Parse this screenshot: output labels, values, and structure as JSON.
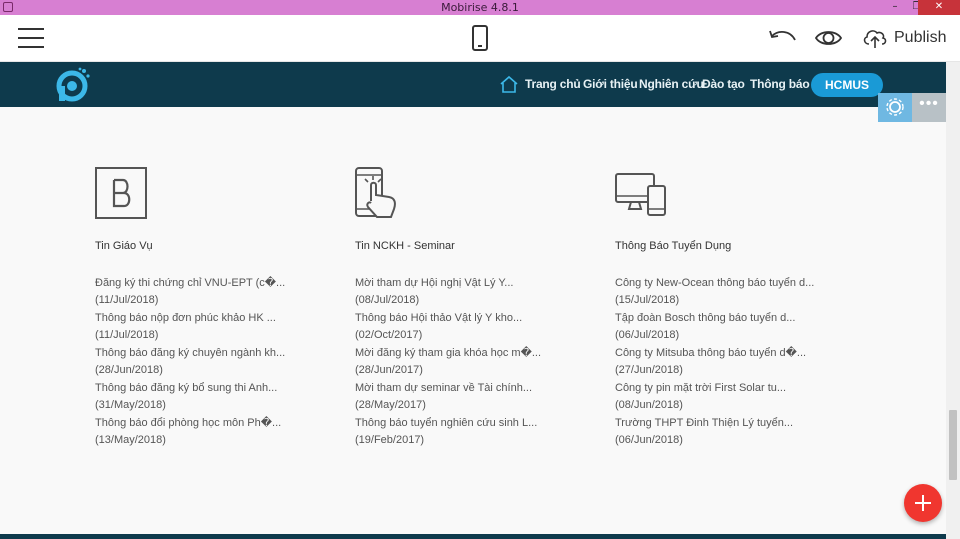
{
  "window": {
    "title": "Mobirise 4.8.1",
    "minimize": "–",
    "restore": "❐",
    "close": "✕"
  },
  "toolbar": {
    "publish_label": "Publish"
  },
  "navbar": {
    "items": [
      "Trang chủ",
      "Giới thiệu",
      "Nghiên cứu",
      "Đào tạo",
      "Thông báo"
    ],
    "cta": "HCMUS"
  },
  "block_controls": {
    "more": "•••"
  },
  "columns": [
    {
      "title": "Tin Giáo Vụ",
      "icon": "b-letter-icon",
      "items": [
        {
          "title": " Đăng ký thi chứng chỉ VNU-EPT (c�...",
          "date": "(11/Jul/2018)"
        },
        {
          "title": "Thông báo nộp đơn phúc khảo HK ...",
          "date": "(11/Jul/2018)"
        },
        {
          "title": "Thông báo đăng ký chuyên ngành kh...",
          "date": "(28/Jun/2018)"
        },
        {
          "title": "Thông báo đăng ký bổ sung thi Anh...",
          "date": "(31/May/2018)"
        },
        {
          "title": "Thông báo đổi phòng học môn Ph�...",
          "date": "(13/May/2018)"
        }
      ]
    },
    {
      "title": "Tin NCKH - Seminar",
      "icon": "touch-phone-icon",
      "items": [
        {
          "title": " Mời tham dự Hội nghị Vật Lý Y...",
          "date": "(08/Jul/2018)"
        },
        {
          "title": "Thông báo Hội thảo Vật lý Y kho...",
          "date": "(02/Oct/2017)"
        },
        {
          "title": "Mời đăng ký tham gia khóa học m�...",
          "date": "(28/Jun/2017)"
        },
        {
          "title": "Mời tham dự seminar về Tài chính...",
          "date": "(28/May/2017)"
        },
        {
          "title": "Thông báo tuyển nghiên cứu sinh L...",
          "date": "(19/Feb/2017)"
        }
      ]
    },
    {
      "title": "Thông Báo Tuyển Dụng",
      "icon": "devices-icon",
      "items": [
        {
          "title": " Công ty New-Ocean thông báo tuyển d...",
          "date": "(15/Jul/2018)"
        },
        {
          "title": "Tập đoàn Bosch thông báo tuyển d...",
          "date": "(06/Jul/2018)"
        },
        {
          "title": "Công ty Mitsuba thông báo tuyển d�...",
          "date": "(27/Jun/2018)"
        },
        {
          "title": "Công ty pin mặt trời First Solar tu...",
          "date": "(08/Jun/2018)"
        },
        {
          "title": "Trường THPT Đinh Thiện Lý tuyển...",
          "date": "(06/Jun/2018)"
        }
      ]
    }
  ],
  "colors": {
    "titlebar": "#d77fd2",
    "navbar": "#0e3a4c",
    "accent": "#1a9ad6",
    "fab": "#f0362f"
  }
}
